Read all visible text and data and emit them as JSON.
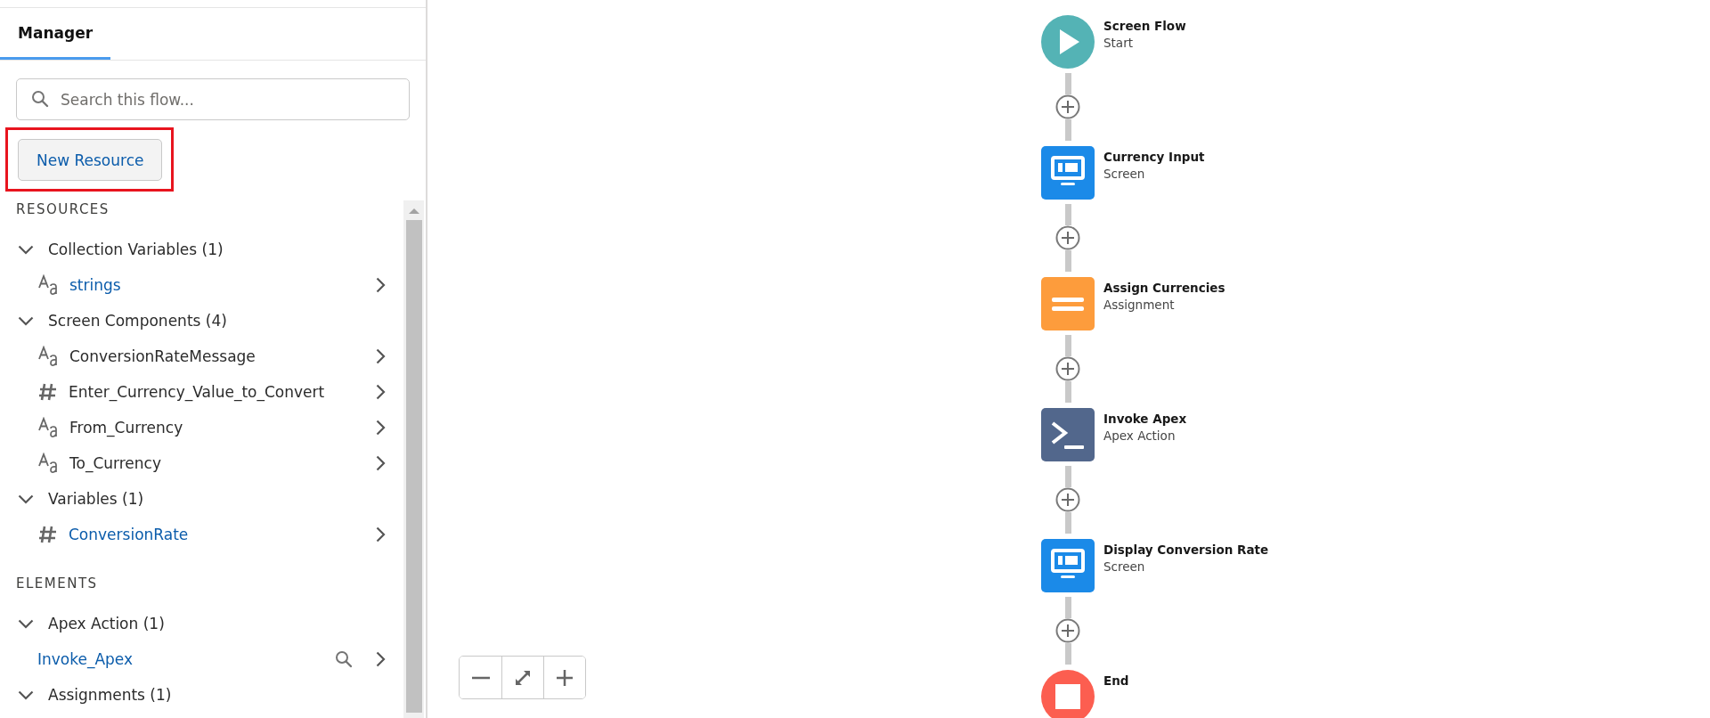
{
  "manager": {
    "tabs": [
      {
        "label": "Manager",
        "selected": true
      }
    ],
    "search": {
      "placeholder": "Search this flow..."
    },
    "new_resource_button": {
      "label": "New Resource",
      "highlighted": true
    },
    "sections": [
      {
        "heading": "RESOURCES",
        "groups": [
          {
            "label": "Collection Variables (1)",
            "expanded": true,
            "items": [
              {
                "kind": "text",
                "label": "strings",
                "link": true
              }
            ]
          },
          {
            "label": "Screen Components (4)",
            "expanded": true,
            "items": [
              {
                "kind": "text",
                "label": "ConversionRateMessage",
                "link": false
              },
              {
                "kind": "number",
                "label": "Enter_Currency_Value_to_Convert",
                "link": false
              },
              {
                "kind": "text",
                "label": "From_Currency",
                "link": false
              },
              {
                "kind": "text",
                "label": "To_Currency",
                "link": false
              }
            ]
          },
          {
            "label": "Variables (1)",
            "expanded": true,
            "items": [
              {
                "kind": "number",
                "label": "ConversionRate",
                "link": true
              }
            ]
          }
        ]
      },
      {
        "heading": "ELEMENTS",
        "groups": [
          {
            "label": "Apex Action (1)",
            "expanded": true,
            "items": [
              {
                "kind": "element",
                "label": "Invoke_Apex",
                "link": true
              }
            ]
          },
          {
            "label": "Assignments (1)",
            "expanded": true
          }
        ]
      }
    ]
  },
  "canvas": {
    "nodes": [
      {
        "kind": "start",
        "title": "Screen Flow",
        "subtitle": "Start"
      },
      {
        "kind": "screen",
        "title": "Currency Input",
        "subtitle": "Screen"
      },
      {
        "kind": "assignment",
        "title": "Assign Currencies",
        "subtitle": "Assignment"
      },
      {
        "kind": "apex",
        "title": "Invoke Apex",
        "subtitle": "Apex Action"
      },
      {
        "kind": "screen",
        "title": "Display Conversion Rate",
        "subtitle": "Screen"
      },
      {
        "kind": "end",
        "title": "End"
      }
    ]
  }
}
